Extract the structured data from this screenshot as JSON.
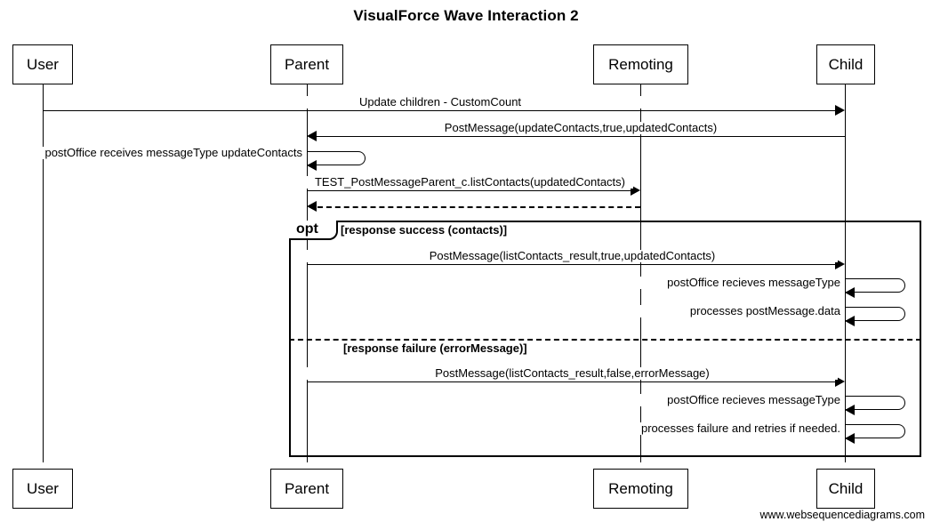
{
  "diagram": {
    "title": "VisualForce Wave Interaction 2",
    "footer": "www.websequencediagrams.com",
    "type": "sequence-diagram"
  },
  "actors": [
    {
      "id": "user",
      "label": "User"
    },
    {
      "id": "parent",
      "label": "Parent"
    },
    {
      "id": "remoting",
      "label": "Remoting"
    },
    {
      "id": "child",
      "label": "Child"
    }
  ],
  "messages": [
    {
      "id": "m1",
      "label": "Update children - CustomCount",
      "from": "user",
      "to": "child",
      "kind": "solid"
    },
    {
      "id": "m2",
      "label": "PostMessage(updateContacts,true,updatedContacts)",
      "from": "child",
      "to": "parent",
      "kind": "solid"
    },
    {
      "id": "m3",
      "label": "postOffice receives messageType updateContacts",
      "from": "parent",
      "to": "parent",
      "kind": "self"
    },
    {
      "id": "m4",
      "label": "TEST_PostMessageParent_c.listContacts(updatedContacts)",
      "from": "parent",
      "to": "remoting",
      "kind": "solid"
    },
    {
      "id": "m5",
      "label": "",
      "from": "remoting",
      "to": "parent",
      "kind": "dashed"
    },
    {
      "id": "m6",
      "label": "PostMessage(listContacts_result,true,updatedContacts)",
      "from": "parent",
      "to": "child",
      "kind": "solid"
    },
    {
      "id": "m7",
      "label": "postOffice recieves messageType",
      "from": "child",
      "to": "child",
      "kind": "self"
    },
    {
      "id": "m8",
      "label": "processes postMessage.data",
      "from": "child",
      "to": "child",
      "kind": "self"
    },
    {
      "id": "m9",
      "label": "PostMessage(listContacts_result,false,errorMessage)",
      "from": "parent",
      "to": "child",
      "kind": "solid"
    },
    {
      "id": "m10",
      "label": "postOffice recieves messageType",
      "from": "child",
      "to": "child",
      "kind": "self"
    },
    {
      "id": "m11",
      "label": "processes failure and retries if needed.",
      "from": "child",
      "to": "child",
      "kind": "self"
    }
  ],
  "fragment": {
    "operator": "opt",
    "guards": [
      "[response success (contacts)]",
      "[response failure (errorMessage)]"
    ]
  },
  "colors": {
    "stroke": "#000000",
    "background": "#ffffff"
  }
}
